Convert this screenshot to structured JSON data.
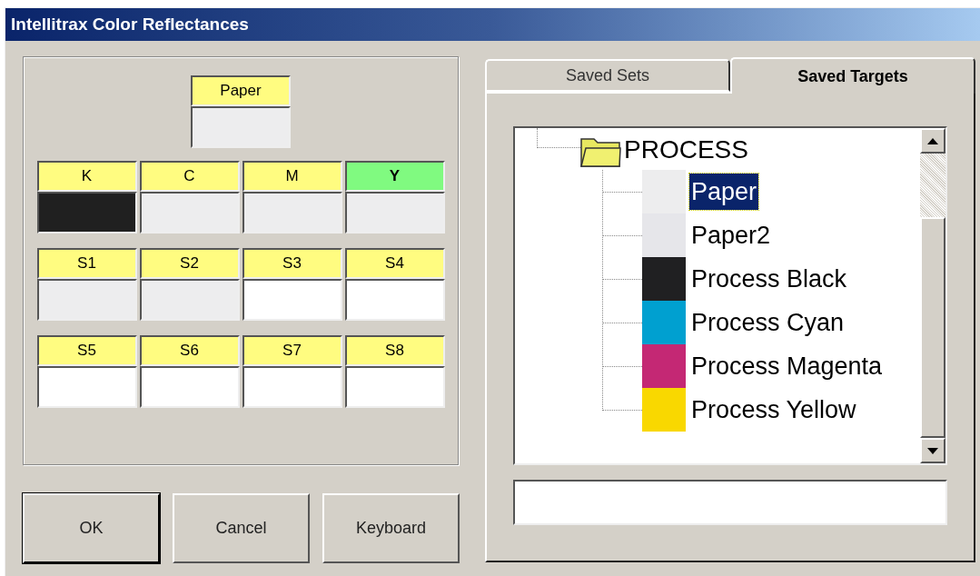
{
  "window": {
    "title": "Intellitrax Color Reflectances"
  },
  "paper": {
    "label": "Paper",
    "selected": false,
    "color": "#ededee"
  },
  "color_rows": [
    [
      {
        "label": "K",
        "selected": false,
        "color": "#202020"
      },
      {
        "label": "C",
        "selected": false,
        "color": "#ededee"
      },
      {
        "label": "M",
        "selected": false,
        "color": "#ededee"
      },
      {
        "label": "Y",
        "selected": true,
        "color": "#ededee"
      }
    ],
    [
      {
        "label": "S1",
        "selected": false,
        "color": "#ededee"
      },
      {
        "label": "S2",
        "selected": false,
        "color": "#ededee"
      },
      {
        "label": "S3",
        "selected": false,
        "color": "#ffffff"
      },
      {
        "label": "S4",
        "selected": false,
        "color": "#ffffff"
      }
    ],
    [
      {
        "label": "S5",
        "selected": false,
        "color": "#ffffff"
      },
      {
        "label": "S6",
        "selected": false,
        "color": "#ffffff"
      },
      {
        "label": "S7",
        "selected": false,
        "color": "#ffffff"
      },
      {
        "label": "S8",
        "selected": false,
        "color": "#ffffff"
      }
    ]
  ],
  "buttons": [
    {
      "label": "OK",
      "default": true
    },
    {
      "label": "Cancel",
      "default": false
    },
    {
      "label": "Keyboard",
      "default": false
    }
  ],
  "tabs": [
    {
      "label": "Saved Sets",
      "selected": false
    },
    {
      "label": "Saved Targets",
      "selected": true
    }
  ],
  "tree": {
    "label": "PROCESS",
    "children": [
      {
        "label": "Paper",
        "selected": true,
        "color": "#ededee"
      },
      {
        "label": "Paper2",
        "selected": false,
        "color": "#e6e6ea"
      },
      {
        "label": "Process Black",
        "selected": false,
        "color": "#202022"
      },
      {
        "label": "Process Cyan",
        "selected": false,
        "color": "#00a0d0"
      },
      {
        "label": "Process Magenta",
        "selected": false,
        "color": "#c42874"
      },
      {
        "label": "Process Yellow",
        "selected": false,
        "color": "#f9d800"
      }
    ]
  }
}
